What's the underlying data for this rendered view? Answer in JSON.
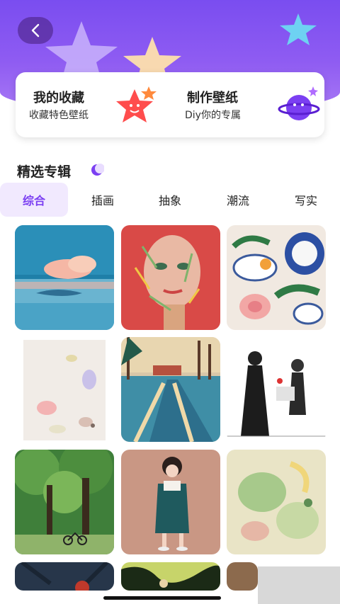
{
  "header": {
    "back_icon": "chevron-left-icon"
  },
  "features": [
    {
      "title": "我的收藏",
      "subtitle": "收藏特色壁纸",
      "icon": "star-face-icon"
    },
    {
      "title": "制作壁纸",
      "subtitle": "Diy你的专属",
      "icon": "planet-icon"
    }
  ],
  "section": {
    "title": "精选专辑",
    "icon": "moon-icon"
  },
  "tabs": [
    {
      "label": "综合",
      "active": true
    },
    {
      "label": "插画",
      "active": false
    },
    {
      "label": "抽象",
      "active": false
    },
    {
      "label": "潮流",
      "active": false
    },
    {
      "label": "写实",
      "active": false
    }
  ],
  "colors": {
    "accent": "#7b3ff2",
    "header": "#8f5cf2",
    "tab_active_bg": "#f1e9fe"
  },
  "wallpapers": [
    {
      "name": "whale-sea-painting"
    },
    {
      "name": "colorful-face-painting"
    },
    {
      "name": "porcelain-flowers-painting"
    },
    {
      "name": "watercolor-abstract"
    },
    {
      "name": "snowy-road-painting"
    },
    {
      "name": "ink-figures-sketch"
    },
    {
      "name": "forest-bicycle-painting"
    },
    {
      "name": "girl-green-dress-illustration"
    },
    {
      "name": "green-abstract-painting"
    },
    {
      "name": "girl-tree-painting"
    },
    {
      "name": "leaves-painting"
    },
    {
      "name": "brown-painting"
    }
  ]
}
